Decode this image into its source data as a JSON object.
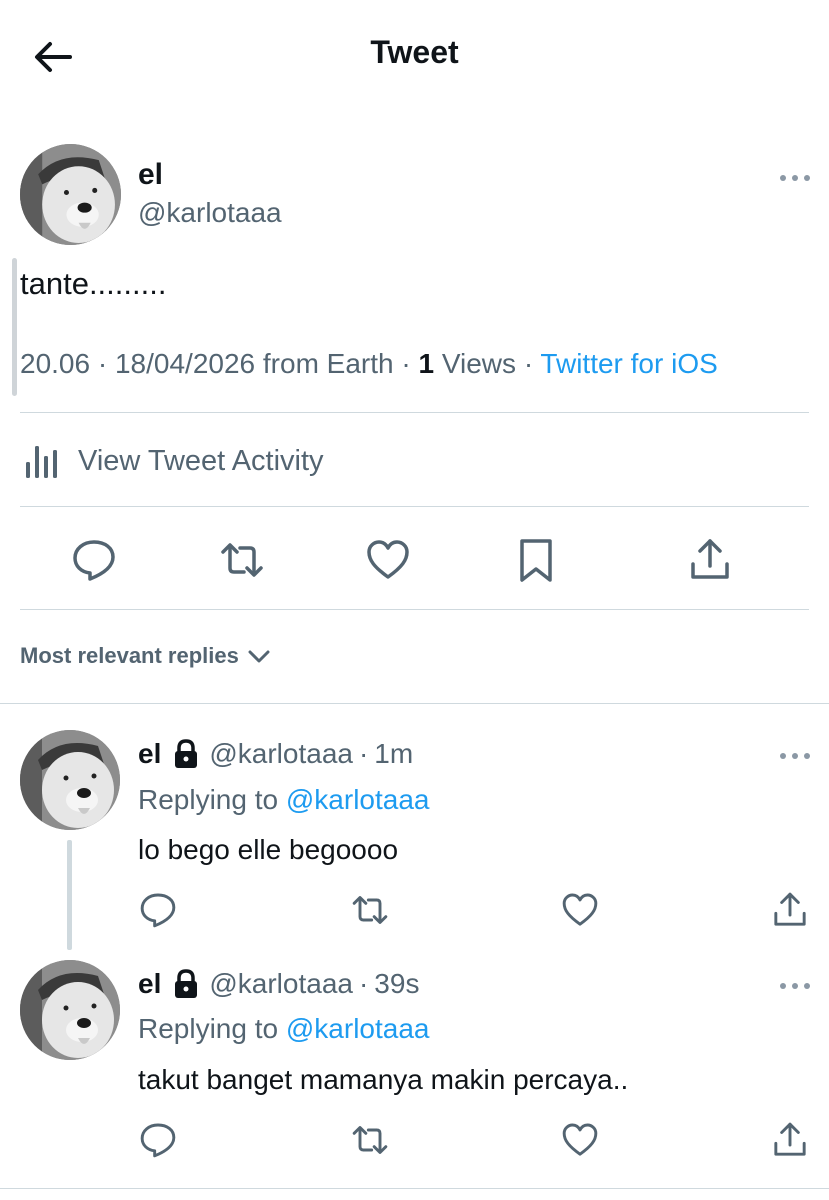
{
  "header": {
    "title": "Tweet"
  },
  "tweet": {
    "author_name": "el",
    "author_handle": "@karlotaaa",
    "text": "tante.........",
    "time": "20.06",
    "date": "18/04/2026",
    "location": "from Earth",
    "views_count": "1",
    "views_label": "Views",
    "source": "Twitter for iOS",
    "sep": "·"
  },
  "activity": {
    "label": "View Tweet Activity"
  },
  "sort": {
    "label": "Most relevant replies"
  },
  "replies": [
    {
      "name": "el",
      "handle": "@karlotaaa",
      "time": "1m",
      "replying_prefix": "Replying to",
      "replying_to": "@karlotaaa",
      "text": "lo bego elle begoooo"
    },
    {
      "name": "el",
      "handle": "@karlotaaa",
      "time": "39s",
      "replying_prefix": "Replying to",
      "replying_to": "@karlotaaa",
      "text": "takut banget mamanya makin percaya.."
    }
  ],
  "icons": {
    "back": "arrow-left-icon",
    "more": "more-horizontal-icon",
    "activity": "bar-chart-icon",
    "reply": "comment-bubble-icon",
    "retweet": "retweet-icon",
    "like": "heart-icon",
    "bookmark": "bookmark-icon",
    "share": "share-upload-icon",
    "lock": "lock-icon",
    "chevron": "chevron-down-icon"
  },
  "colors": {
    "accent": "#1d9bf0",
    "secondary_text": "#536471",
    "primary_text": "#0f1419",
    "divider": "#cfd9de"
  }
}
